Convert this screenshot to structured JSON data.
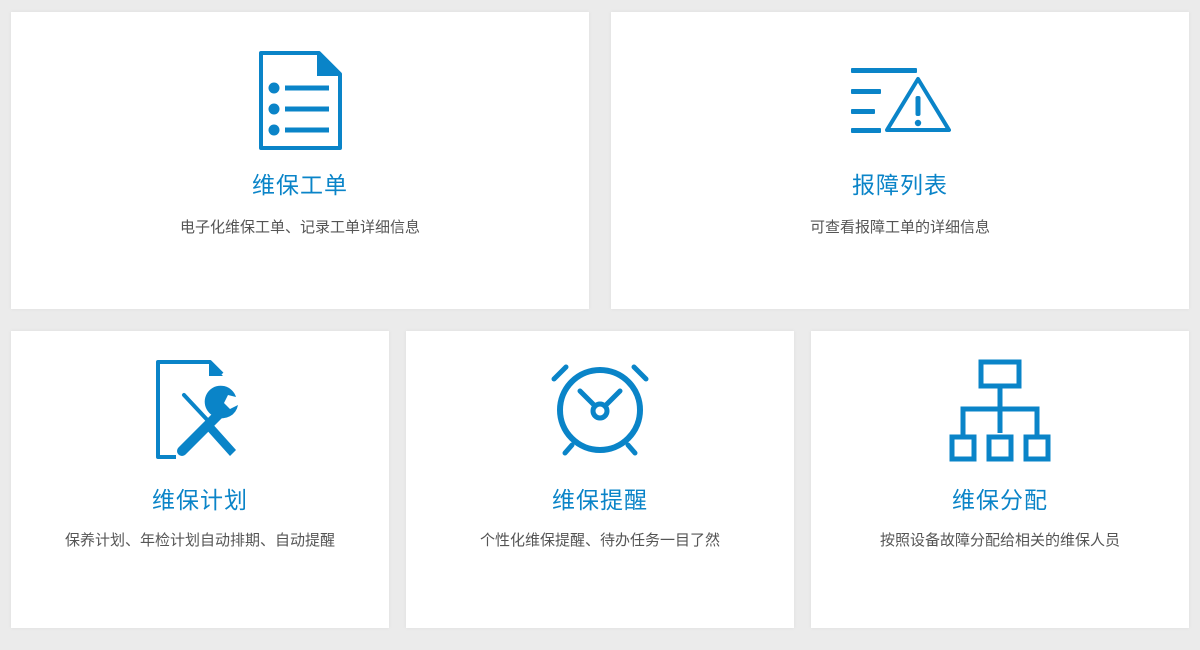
{
  "accent_color": "#0a84c8",
  "cards": [
    {
      "title": "维保工单",
      "desc": "电子化维保工单、记录工单详细信息",
      "icon": "document-list-icon"
    },
    {
      "title": "报障列表",
      "desc": "可查看报障工单的详细信息",
      "icon": "warning-list-icon"
    },
    {
      "title": "维保计划",
      "desc": "保养计划、年检计划自动排期、自动提醒",
      "icon": "maintenance-tools-icon"
    },
    {
      "title": "维保提醒",
      "desc": "个性化维保提醒、待办任务一目了然",
      "icon": "alarm-clock-icon"
    },
    {
      "title": "维保分配",
      "desc": "按照设备故障分配给相关的维保人员",
      "icon": "org-chart-icon"
    }
  ]
}
